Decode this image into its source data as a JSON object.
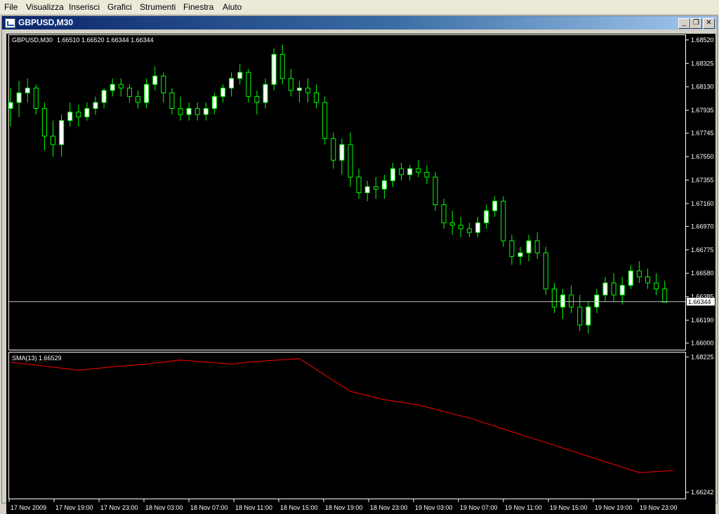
{
  "menu": {
    "items": [
      "File",
      "Visualizza",
      "Inserisci",
      "Grafici",
      "Strumenti",
      "Finestra",
      "Aiuto"
    ]
  },
  "window": {
    "title": "GBPUSD,M30",
    "icon": "chart-icon",
    "buttons": {
      "minimize": "_",
      "restore": "❐",
      "close": "✕"
    }
  },
  "colors": {
    "background": "#000000",
    "axis": "#ffffff",
    "bull_candle": "#ffffff",
    "bear_candle": "#000000",
    "wick": "#00ff00",
    "sma": "#ff0000",
    "bid_line": "#c0c0c0"
  },
  "chart_data": [
    {
      "type": "candlestick",
      "symbol_label": "GBPUSD,M30",
      "ohlc_label": "1.66510 1.66520 1.66344 1.66344",
      "y_ticks": [
        "1.68520",
        "1.68325",
        "1.68130",
        "1.67935",
        "1.67745",
        "1.67550",
        "1.67355",
        "1.67160",
        "1.66970",
        "1.66775",
        "1.66580",
        "1.66385",
        "1.66190",
        "1.66000"
      ],
      "ylim": [
        1.65945,
        1.6856
      ],
      "current_price": 1.66344,
      "current_price_label": "1.66344",
      "ohlc": [
        [
          1.6795,
          1.6812,
          1.678,
          1.68
        ],
        [
          1.68,
          1.6818,
          1.6788,
          1.6808
        ],
        [
          1.6808,
          1.682,
          1.68,
          1.6812
        ],
        [
          1.6812,
          1.6815,
          1.679,
          1.6795
        ],
        [
          1.6795,
          1.68,
          1.676,
          1.6772
        ],
        [
          1.6772,
          1.6785,
          1.6755,
          1.6765
        ],
        [
          1.6765,
          1.679,
          1.6755,
          1.6785
        ],
        [
          1.6785,
          1.68,
          1.678,
          1.6792
        ],
        [
          1.6792,
          1.6798,
          1.678,
          1.6788
        ],
        [
          1.6788,
          1.68,
          1.6785,
          1.6795
        ],
        [
          1.6795,
          1.6805,
          1.679,
          1.68
        ],
        [
          1.68,
          1.6812,
          1.6795,
          1.681
        ],
        [
          1.681,
          1.682,
          1.6805,
          1.6815
        ],
        [
          1.6815,
          1.682,
          1.6805,
          1.6812
        ],
        [
          1.6812,
          1.6815,
          1.68,
          1.6805
        ],
        [
          1.6805,
          1.681,
          1.6795,
          1.68
        ],
        [
          1.68,
          1.682,
          1.6795,
          1.6815
        ],
        [
          1.6815,
          1.683,
          1.681,
          1.6822
        ],
        [
          1.6822,
          1.6825,
          1.68,
          1.6808
        ],
        [
          1.6808,
          1.6812,
          1.679,
          1.6795
        ],
        [
          1.6795,
          1.6805,
          1.6785,
          1.679
        ],
        [
          1.679,
          1.68,
          1.6785,
          1.6795
        ],
        [
          1.6795,
          1.68,
          1.6785,
          1.679
        ],
        [
          1.679,
          1.68,
          1.6785,
          1.6795
        ],
        [
          1.6795,
          1.6808,
          1.679,
          1.6805
        ],
        [
          1.6805,
          1.6815,
          1.68,
          1.6812
        ],
        [
          1.6812,
          1.6825,
          1.6805,
          1.682
        ],
        [
          1.682,
          1.6832,
          1.6815,
          1.6825
        ],
        [
          1.6825,
          1.6828,
          1.68,
          1.6805
        ],
        [
          1.6805,
          1.681,
          1.679,
          1.68
        ],
        [
          1.68,
          1.682,
          1.6795,
          1.6815
        ],
        [
          1.6815,
          1.6845,
          1.681,
          1.684
        ],
        [
          1.684,
          1.6848,
          1.6815,
          1.682
        ],
        [
          1.682,
          1.6828,
          1.6805,
          1.681
        ],
        [
          1.681,
          1.6818,
          1.68,
          1.6812
        ],
        [
          1.6812,
          1.682,
          1.68,
          1.6808
        ],
        [
          1.6808,
          1.6815,
          1.6795,
          1.68
        ],
        [
          1.68,
          1.6805,
          1.6765,
          1.677
        ],
        [
          1.677,
          1.6775,
          1.6745,
          1.6752
        ],
        [
          1.6752,
          1.677,
          1.674,
          1.6765
        ],
        [
          1.6765,
          1.6775,
          1.673,
          1.6738
        ],
        [
          1.6738,
          1.6745,
          1.672,
          1.6725
        ],
        [
          1.6725,
          1.6735,
          1.6718,
          1.673
        ],
        [
          1.673,
          1.6738,
          1.672,
          1.6728
        ],
        [
          1.6728,
          1.674,
          1.672,
          1.6735
        ],
        [
          1.6735,
          1.675,
          1.673,
          1.6745
        ],
        [
          1.6745,
          1.675,
          1.6735,
          1.674
        ],
        [
          1.674,
          1.6748,
          1.6735,
          1.6745
        ],
        [
          1.6745,
          1.6752,
          1.6738,
          1.6742
        ],
        [
          1.6742,
          1.6748,
          1.6732,
          1.6738
        ],
        [
          1.6738,
          1.6742,
          1.671,
          1.6715
        ],
        [
          1.6715,
          1.672,
          1.6695,
          1.67
        ],
        [
          1.67,
          1.671,
          1.669,
          1.6698
        ],
        [
          1.6698,
          1.6705,
          1.6688,
          1.6695
        ],
        [
          1.6695,
          1.67,
          1.6688,
          1.6692
        ],
        [
          1.6692,
          1.6705,
          1.6688,
          1.67
        ],
        [
          1.67,
          1.6715,
          1.6695,
          1.671
        ],
        [
          1.671,
          1.6722,
          1.6705,
          1.6718
        ],
        [
          1.6718,
          1.6722,
          1.668,
          1.6685
        ],
        [
          1.6685,
          1.669,
          1.6665,
          1.6672
        ],
        [
          1.6672,
          1.668,
          1.6665,
          1.6675
        ],
        [
          1.6675,
          1.669,
          1.6668,
          1.6685
        ],
        [
          1.6685,
          1.6692,
          1.667,
          1.6675
        ],
        [
          1.6675,
          1.668,
          1.664,
          1.6645
        ],
        [
          1.6645,
          1.665,
          1.6625,
          1.663
        ],
        [
          1.663,
          1.6645,
          1.662,
          1.664
        ],
        [
          1.664,
          1.6648,
          1.6625,
          1.663
        ],
        [
          1.663,
          1.664,
          1.661,
          1.6615
        ],
        [
          1.6615,
          1.6635,
          1.6608,
          1.663
        ],
        [
          1.663,
          1.6645,
          1.6625,
          1.664
        ],
        [
          1.664,
          1.6655,
          1.6635,
          1.665
        ],
        [
          1.665,
          1.6658,
          1.6635,
          1.664
        ],
        [
          1.664,
          1.6655,
          1.6632,
          1.6648
        ],
        [
          1.6648,
          1.6665,
          1.6645,
          1.666
        ],
        [
          1.666,
          1.6668,
          1.665,
          1.6655
        ],
        [
          1.6655,
          1.6662,
          1.6645,
          1.665
        ],
        [
          1.665,
          1.6658,
          1.664,
          1.6645
        ],
        [
          1.6645,
          1.6652,
          1.6634,
          1.6634
        ]
      ]
    },
    {
      "type": "line",
      "indicator_label": "SMA(13) 1.66529",
      "y_ticks": [
        "1.68225",
        "1.66242"
      ],
      "ylim": [
        1.6615,
        1.6829
      ],
      "series": [
        {
          "name": "SMA(13)",
          "x": [
            0,
            8,
            12,
            16,
            20,
            26,
            28,
            34,
            40,
            44,
            48,
            54,
            58,
            64,
            70,
            74,
            78
          ],
          "values": [
            1.6815,
            1.6803,
            1.6808,
            1.6812,
            1.6818,
            1.6812,
            1.6815,
            1.682,
            1.6772,
            1.676,
            1.6752,
            1.6733,
            1.6717,
            1.6693,
            1.6669,
            1.6653,
            1.6656
          ]
        }
      ]
    }
  ],
  "x_ticks": [
    "17 Nov 2009",
    "17 Nov 19:00",
    "17 Nov 23:00",
    "18 Nov 03:00",
    "18 Nov 07:00",
    "18 Nov 11:00",
    "18 Nov 15:00",
    "18 Nov 19:00",
    "18 Nov 23:00",
    "19 Nov 03:00",
    "19 Nov 07:00",
    "19 Nov 11:00",
    "19 Nov 15:00",
    "19 Nov 19:00",
    "19 Nov 23:00"
  ]
}
